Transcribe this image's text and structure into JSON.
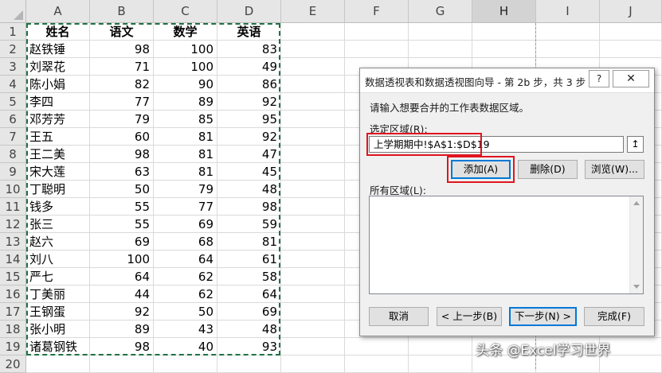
{
  "spreadsheet": {
    "columns": [
      "A",
      "B",
      "C",
      "D",
      "E",
      "F",
      "G",
      "H",
      "I",
      "J"
    ],
    "selected_column": "H",
    "headers": [
      "姓名",
      "语文",
      "数学",
      "英语"
    ],
    "rows": [
      [
        "赵铁锤",
        "98",
        "100",
        "83"
      ],
      [
        "刘翠花",
        "71",
        "100",
        "49"
      ],
      [
        "陈小娟",
        "82",
        "90",
        "86"
      ],
      [
        "李四",
        "77",
        "89",
        "92"
      ],
      [
        "邓芳芳",
        "79",
        "85",
        "95"
      ],
      [
        "王五",
        "60",
        "81",
        "92"
      ],
      [
        "王二美",
        "98",
        "81",
        "47"
      ],
      [
        "宋大莲",
        "63",
        "81",
        "45"
      ],
      [
        "丁聪明",
        "50",
        "79",
        "48"
      ],
      [
        "钱多",
        "55",
        "77",
        "98"
      ],
      [
        "张三",
        "55",
        "69",
        "59"
      ],
      [
        "赵六",
        "69",
        "68",
        "81"
      ],
      [
        "刘八",
        "100",
        "64",
        "61"
      ],
      [
        "严七",
        "64",
        "62",
        "58"
      ],
      [
        "丁美丽",
        "44",
        "62",
        "64"
      ],
      [
        "王钢蛋",
        "92",
        "50",
        "69"
      ],
      [
        "张小明",
        "89",
        "43",
        "48"
      ],
      [
        "诸葛钢铁",
        "98",
        "40",
        "93"
      ]
    ],
    "row_numbers": [
      "1",
      "2",
      "3",
      "4",
      "5",
      "6",
      "7",
      "8",
      "9",
      "10",
      "11",
      "12",
      "13",
      "14",
      "15",
      "16",
      "17",
      "18",
      "19",
      "20"
    ]
  },
  "dialog": {
    "title": "数据透视表和数据透视图向导 - 第 2b 步，共 3 步",
    "help_label": "?",
    "close_label": "✕",
    "instruction": "请输入想要合并的工作表数据区域。",
    "range_label": "选定区域(R):",
    "range_value": "上学期期中!$A$1:$D$19",
    "collapse_icon": "↥",
    "add_label": "添加(A)",
    "delete_label": "删除(D)",
    "browse_label": "浏览(W)...",
    "all_ranges_label": "所有区域(L):",
    "cancel_label": "取消",
    "back_label": "< 上一步(B)",
    "next_label": "下一步(N) >",
    "finish_label": "完成(F)"
  },
  "watermark": "头条 @Excel学习世界",
  "colors": {
    "highlight_red": "#e0151e",
    "marquee_green": "#1e7145",
    "primary_blue": "#0078d7"
  }
}
